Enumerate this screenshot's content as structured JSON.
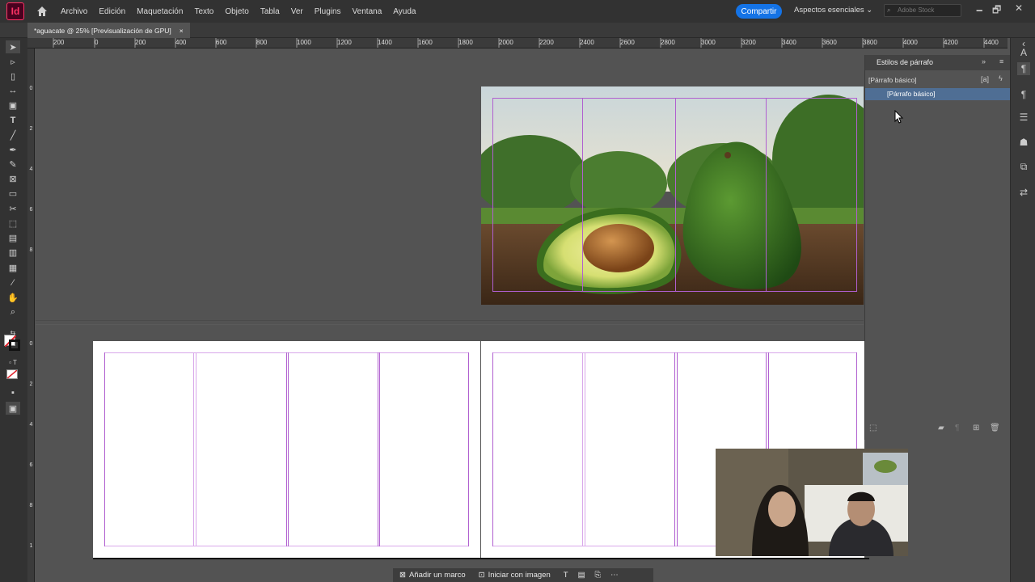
{
  "app": {
    "logo": "Id"
  },
  "menu": {
    "items": [
      "Archivo",
      "Edición",
      "Maquetación",
      "Texto",
      "Objeto",
      "Tabla",
      "Ver",
      "Plugins",
      "Ventana",
      "Ayuda"
    ]
  },
  "header": {
    "share_label": "Compartir",
    "workspace_label": "Aspectos esenciales",
    "stock_placeholder": "Adobe Stock"
  },
  "window_controls": {
    "minimize": "🗕",
    "maximize": "🗗",
    "close": "✕"
  },
  "tab": {
    "title": "*aguacate @ 25% [Previsualización de GPU]",
    "close": "×"
  },
  "ruler": {
    "h_labels": [
      "200",
      "0",
      "200",
      "400",
      "600",
      "800",
      "1000",
      "1200",
      "1400",
      "1600",
      "1800",
      "2000",
      "2200",
      "2400",
      "2600",
      "2800",
      "3000",
      "3200",
      "3400",
      "3600",
      "3800",
      "4000",
      "4200",
      "4400"
    ],
    "v_labels": [
      "0",
      "2",
      "4",
      "6",
      "8",
      "0",
      "2",
      "4",
      "6",
      "8",
      "1"
    ]
  },
  "panel": {
    "title": "Estilos de párrafo",
    "current_style": "[Párrafo básico]",
    "selected_item": "[Párrafo básico]"
  },
  "bottom_bar": {
    "add_frame": "Añadir un marco",
    "start_image": "Iniciar con imagen"
  },
  "colors": {
    "accent": "#1473e6",
    "selection": "#4f6e94",
    "guide": "#b05fd0",
    "brand": "#ff3366"
  }
}
